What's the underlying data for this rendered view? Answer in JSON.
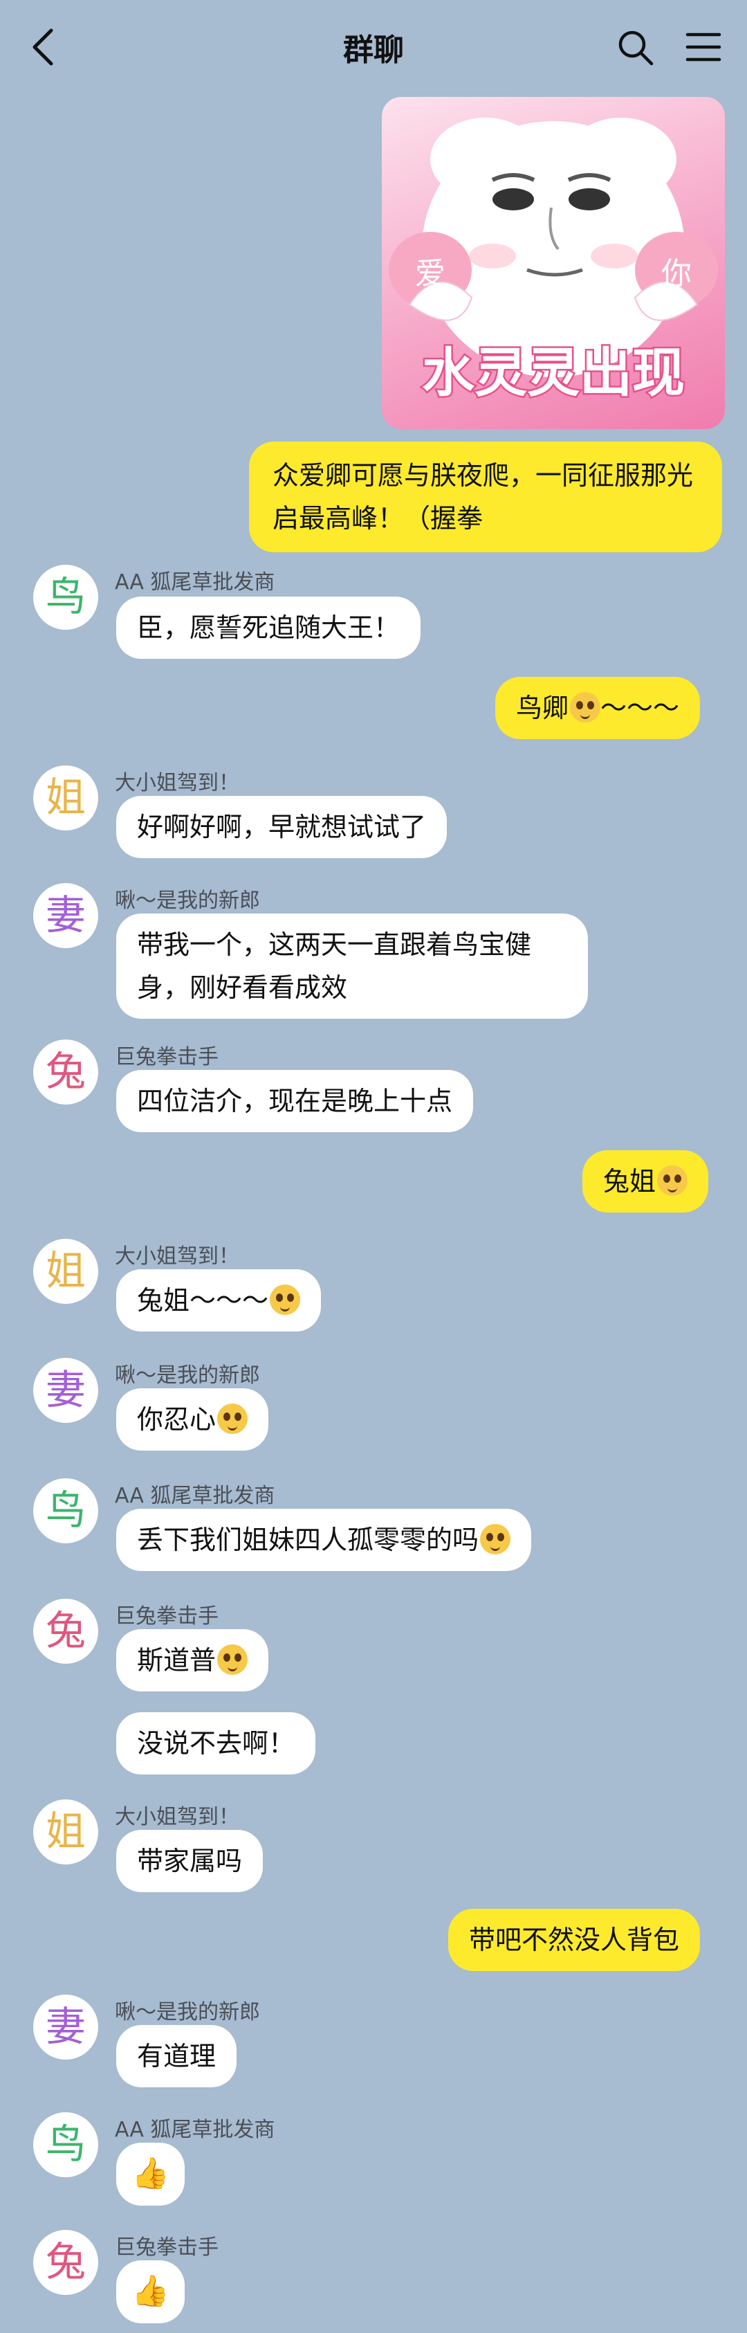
{
  "header": {
    "title": "群聊"
  },
  "sticker": {
    "caption": "水灵灵出现",
    "left_word": "爱",
    "right_word": "你"
  },
  "avatars": {
    "bird": "鸟",
    "lady": "姐",
    "wife": "妻",
    "rabbit": "兔"
  },
  "messages": [
    {
      "id": "m1",
      "side": "right",
      "text": "众爱卿可愿与朕夜爬，一同征服那光启最高峰！（握拳"
    },
    {
      "id": "m2",
      "side": "left",
      "sender": "AA 狐尾草批发商",
      "avatar": "bird",
      "text": "臣，愿誓死追随大王！"
    },
    {
      "id": "m3",
      "side": "right",
      "text": "鸟卿",
      "trail": "～～～"
    },
    {
      "id": "m4",
      "side": "left",
      "sender": "大小姐驾到！",
      "avatar": "lady",
      "text": "好啊好啊，早就想试试了"
    },
    {
      "id": "m5",
      "side": "left",
      "sender": "啾～是我的新郎",
      "avatar": "wife",
      "text": "带我一个，这两天一直跟着鸟宝健身，刚好看看成效"
    },
    {
      "id": "m6",
      "side": "left",
      "sender": "巨兔拳击手",
      "avatar": "rabbit",
      "text": "四位洁介，现在是晚上十点"
    },
    {
      "id": "m7",
      "side": "right",
      "text": "兔姐"
    },
    {
      "id": "m8",
      "side": "left",
      "sender": "大小姐驾到！",
      "avatar": "lady",
      "text": "兔姐～～～"
    },
    {
      "id": "m9",
      "side": "left",
      "sender": "啾～是我的新郎",
      "avatar": "wife",
      "text": "你忍心"
    },
    {
      "id": "m10",
      "side": "left",
      "sender": "AA 狐尾草批发商",
      "avatar": "bird",
      "text": "丢下我们姐妹四人孤零零的吗"
    },
    {
      "id": "m11",
      "side": "left",
      "sender": "巨兔拳击手",
      "avatar": "rabbit",
      "text": "斯道普"
    },
    {
      "id": "m12",
      "side": "left",
      "text": "没说不去啊！"
    },
    {
      "id": "m13",
      "side": "left",
      "sender": "大小姐驾到！",
      "avatar": "lady",
      "text": "带家属吗"
    },
    {
      "id": "m14",
      "side": "right",
      "text": "带吧不然没人背包"
    },
    {
      "id": "m15",
      "side": "left",
      "sender": "啾～是我的新郎",
      "avatar": "wife",
      "text": "有道理"
    },
    {
      "id": "m16",
      "side": "left",
      "sender": "AA 狐尾草批发商",
      "avatar": "bird",
      "text": "👍"
    },
    {
      "id": "m17",
      "side": "left",
      "sender": "巨兔拳击手",
      "avatar": "rabbit",
      "text": "👍"
    }
  ],
  "colors": {
    "background": "#a7bbd1",
    "mine_bubble": "#fdea2c",
    "other_bubble": "#ffffff"
  }
}
